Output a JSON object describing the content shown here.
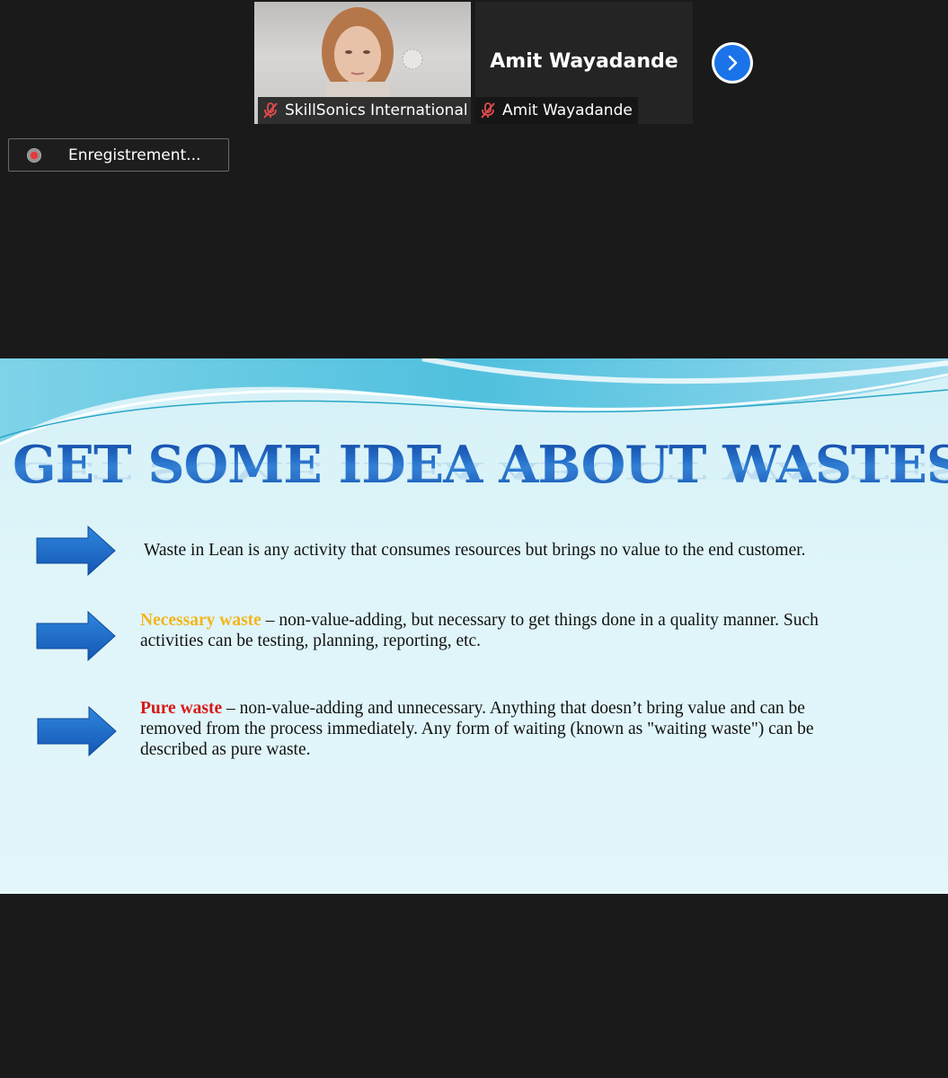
{
  "participants": [
    {
      "label": "SkillSonics International",
      "has_video": true
    },
    {
      "display_name": "Amit Wayadande",
      "label": "Amit Wayadande",
      "has_video": false
    }
  ],
  "next_button_icon": "chevron-right-icon",
  "recording": {
    "label": "Enregistrement..."
  },
  "slide": {
    "title": "GET SOME IDEA ABOUT WASTES",
    "bullets": [
      {
        "text": "Waste in Lean is any activity that consumes resources but brings no value to the end customer."
      },
      {
        "keyword": "Necessary waste",
        "text": " – non-value-adding, but necessary to get things done in a quality manner. Such activities can be testing, planning, reporting, etc."
      },
      {
        "keyword": "Pure waste",
        "text": " – non-value-adding and unnecessary. Anything that doesn’t bring value and can be removed from the process immediately. Any form of waiting (known as \"waiting waste\") can be described as pure waste."
      }
    ]
  },
  "colors": {
    "accent_blue": "#1a73e8",
    "necessary_keyword": "#f3b51b",
    "pure_keyword": "#d81818",
    "title_blue": "#1f5fbf"
  }
}
